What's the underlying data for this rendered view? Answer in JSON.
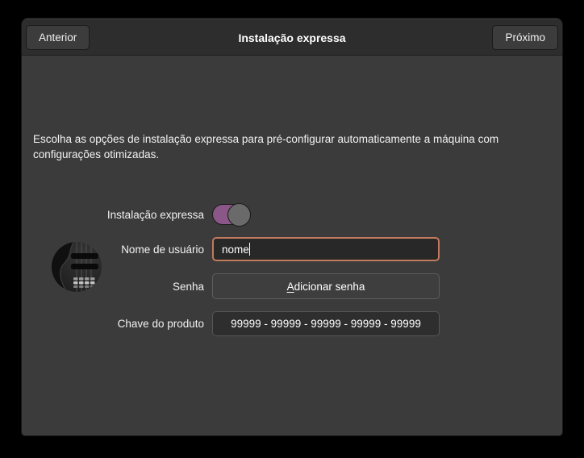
{
  "titlebar": {
    "back_label": "Anterior",
    "title": "Instalação expressa",
    "next_label": "Próximo"
  },
  "intro": {
    "lines": [
      "Escolha as opções de instalação expressa para pré-configurar automaticamente a máquina com",
      "configurações otimizadas."
    ]
  },
  "form": {
    "express": {
      "label": "Instalação expressa",
      "state": "on"
    },
    "username": {
      "label": "Nome de usuário",
      "value": "nome"
    },
    "password": {
      "label": "Senha",
      "button_mnemonic": "A",
      "button_rest": "dicionar senha",
      "button_label": "Adicionar senha"
    },
    "product_key": {
      "label": "Chave do produto",
      "value": "99999 - 99999 - 99999 - 99999 - 99999"
    }
  },
  "icons": {
    "avatar": "bass-guitar-avatar"
  },
  "colors": {
    "toggle_on": "#8a5788",
    "focus_ring": "#c27a5c",
    "window_bg": "#3b3b3b",
    "header_bg": "#2d2d2d"
  }
}
